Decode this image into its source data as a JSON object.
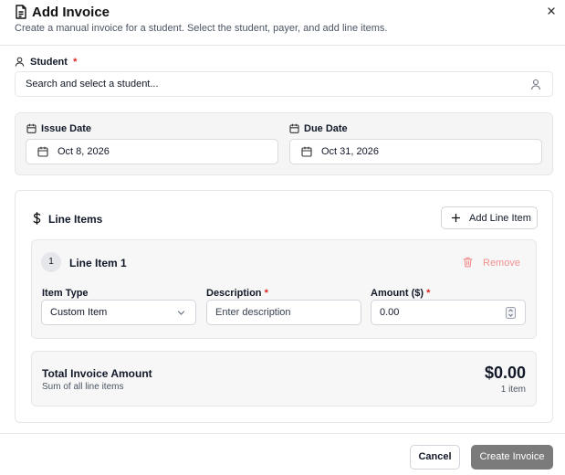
{
  "dialog": {
    "title": "Add Invoice",
    "subtitle": "Create a manual invoice for a student. Select the student, payer, and add line items.",
    "icon": "file-text-icon"
  },
  "student": {
    "label": "Student",
    "required_mark": "*",
    "placeholder": "Search and select a student..."
  },
  "dates": {
    "issue_label": "Issue Date",
    "issue_value": "Oct 8, 2026",
    "due_label": "Due Date",
    "due_value": "Oct 31, 2026"
  },
  "line_items": {
    "title": "Line Items",
    "add_label": "Add Line Item",
    "items": [
      {
        "number": "1",
        "name": "Line Item 1",
        "remove_label": "Remove",
        "type_label": "Item Type",
        "type_value": "Custom Item",
        "description_label": "Description",
        "description_placeholder": "Enter description",
        "amount_label": "Amount ($)",
        "amount_value": "0.00"
      }
    ]
  },
  "total": {
    "title": "Total Invoice Amount",
    "subtitle": "Sum of all line items",
    "amount": "$0.00",
    "count": "1 item"
  },
  "footer": {
    "cancel_label": "Cancel",
    "create_label": "Create Invoice"
  },
  "colors": {
    "required": "#dc2626",
    "remove": "#f29090",
    "primary_button": "#7b7b7b",
    "panel_bg": "#f5f5f5"
  }
}
